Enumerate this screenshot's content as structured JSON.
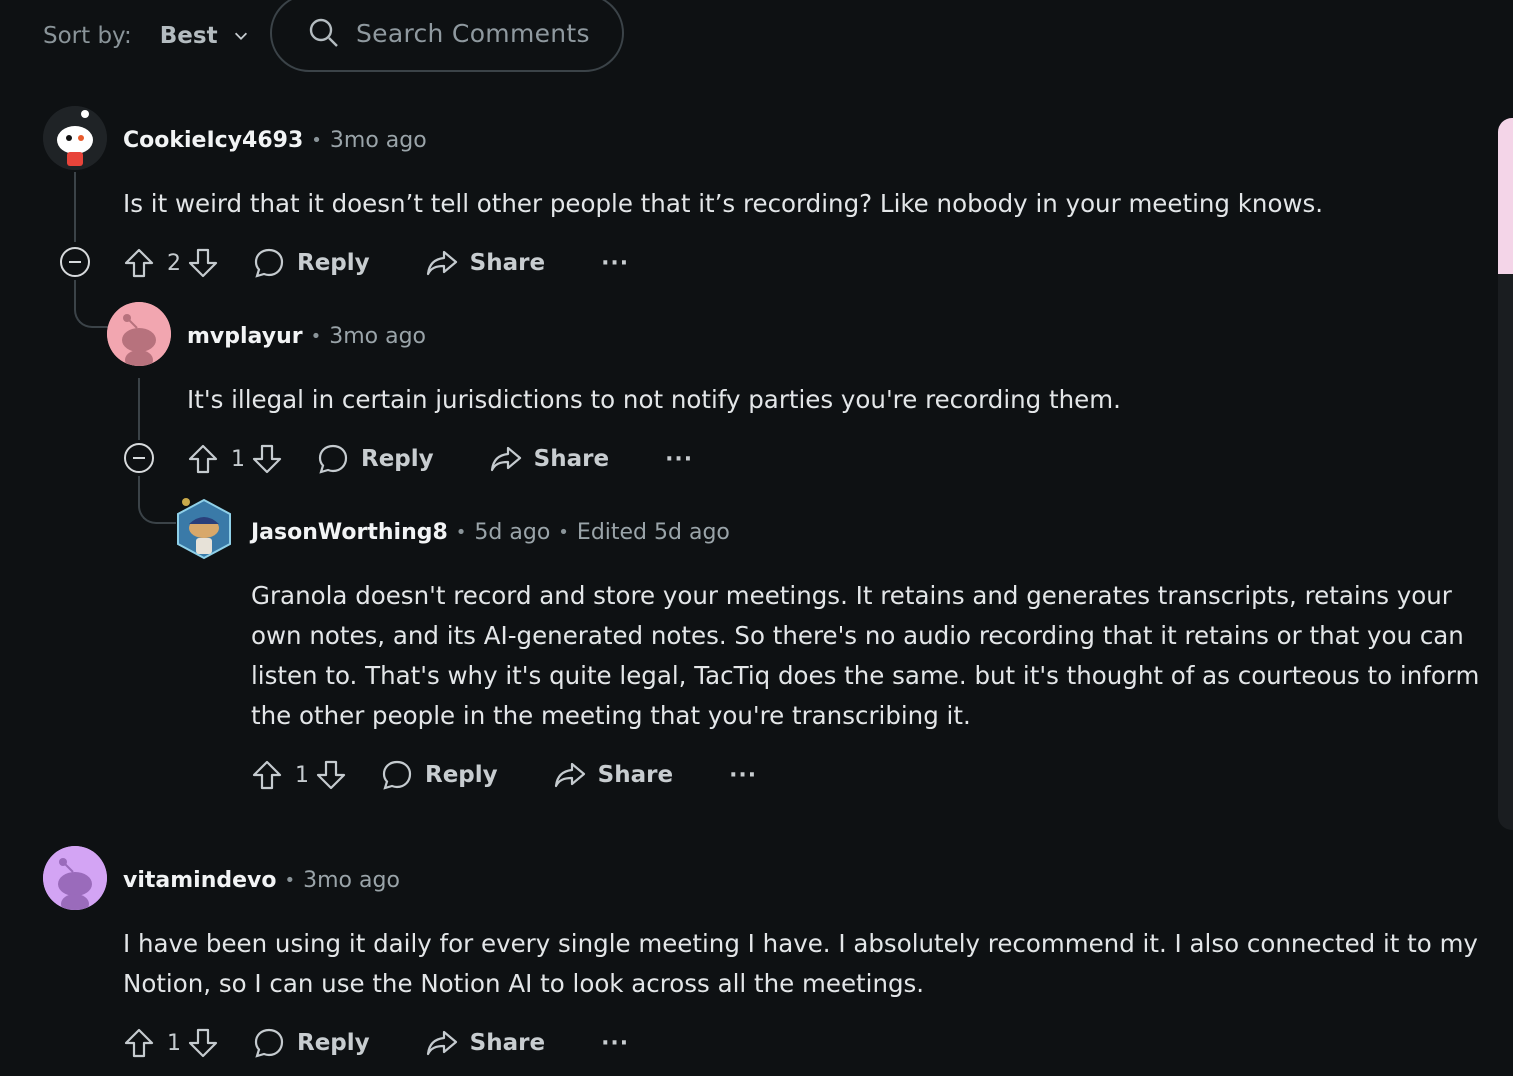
{
  "sort": {
    "label": "Sort by:",
    "value": "Best"
  },
  "search": {
    "placeholder": "Search Comments"
  },
  "comments": [
    {
      "user": "CookieIcy4693",
      "time": "3mo ago",
      "text": "Is it weird that it doesn’t tell other people that it’s recording? Like nobody in your meeting knows.",
      "votes": "2",
      "reply_label": "Reply",
      "share_label": "Share",
      "more_label": "···"
    },
    {
      "user": "mvplayur",
      "time": "3mo ago",
      "text": "It's illegal in certain jurisdictions to not notify parties you're recording them.",
      "votes": "1",
      "reply_label": "Reply",
      "share_label": "Share",
      "more_label": "···"
    },
    {
      "user": "JasonWorthing8",
      "time": "5d ago",
      "edited": "Edited 5d ago",
      "text_lines": [
        "Granola doesn't record and store your meetings. It retains and generates transcripts, retains your",
        "own notes, and its AI-generated notes. So there's no audio recording that it retains or that you can",
        "listen to. That's why it's quite legal, TacTiq does the same. but it's thought of as courteous to inform",
        "the other people in the meeting that you're transcribing it."
      ],
      "votes": "1",
      "reply_label": "Reply",
      "share_label": "Share",
      "more_label": "···"
    },
    {
      "user": "vitamindevo",
      "time": "3mo ago",
      "text_lines": [
        "I have been using it daily for every single meeting I have. I absolutely recommend it. I also connected it to my",
        "Notion, so I can use the Notion AI to look across all the meetings."
      ],
      "votes": "1",
      "reply_label": "Reply",
      "share_label": "Share",
      "more_label": "···"
    }
  ],
  "colors": {
    "background": "#0e1113",
    "thread_line": "#3b4348",
    "avatar_pink": "#f2a6b0",
    "avatar_purple": "#d3a4f4"
  }
}
